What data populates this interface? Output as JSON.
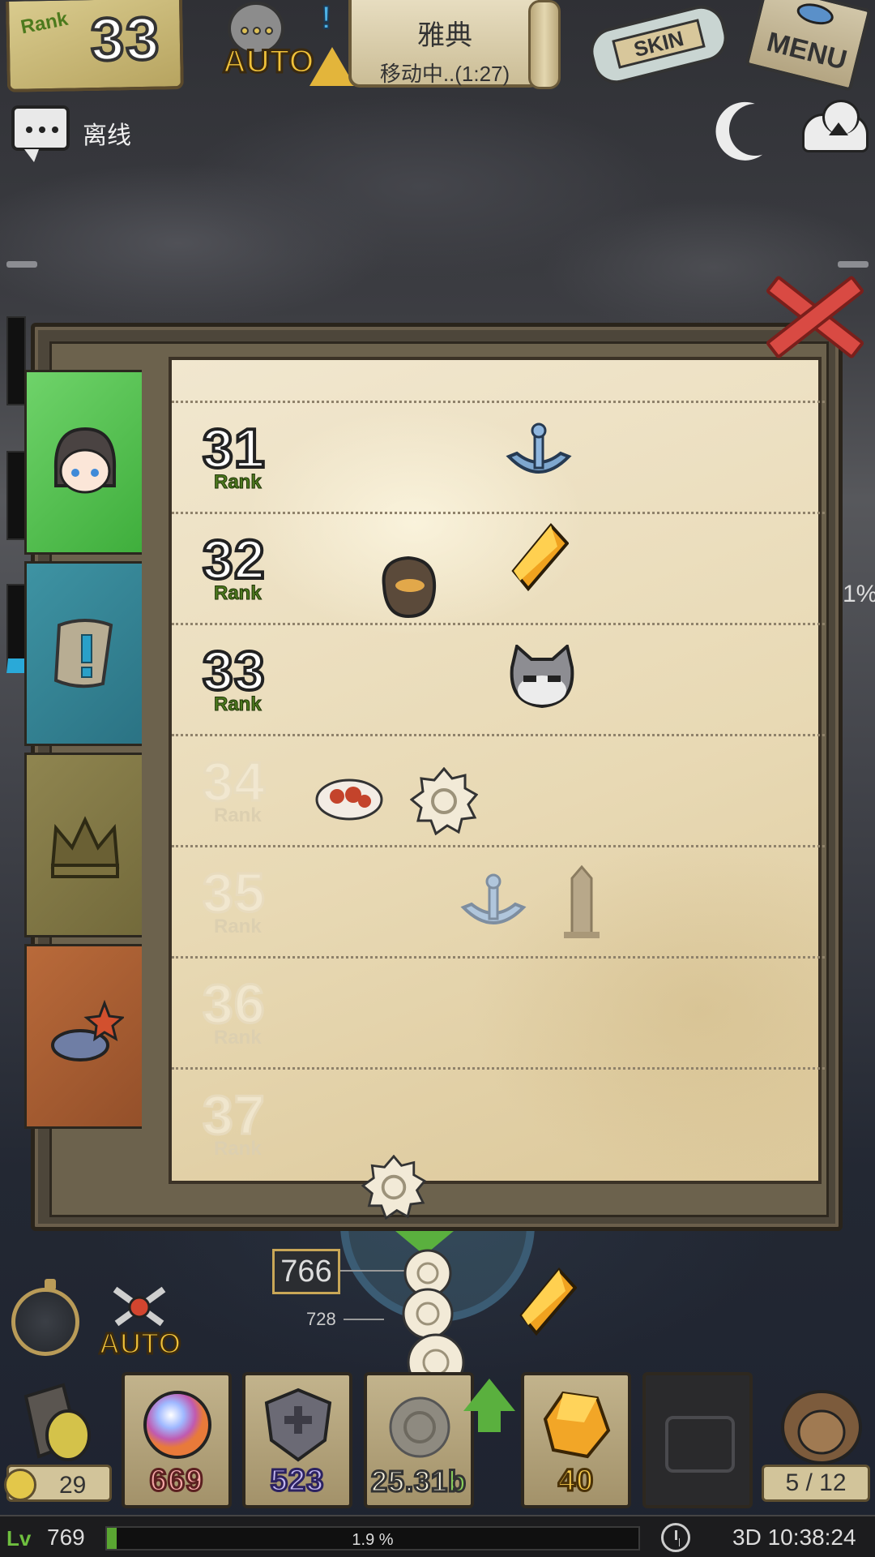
{
  "hud": {
    "rank_label": "Rank",
    "rank_value": "33",
    "auto_label": "AUTO",
    "location": {
      "city": "雅典",
      "status": "移动中..(1:27)"
    },
    "skin_label": "SKIN",
    "menu_label": "MENU",
    "chat_status": "离线",
    "right_percent": "1%"
  },
  "rank_rewards": {
    "rank_word": "Rank",
    "rows": [
      {
        "rank": "31",
        "locked": false,
        "rewards": [
          "anchor-icon"
        ]
      },
      {
        "rank": "32",
        "locked": false,
        "rewards": [
          "ore-icon",
          "amber-gem-icon"
        ]
      },
      {
        "rank": "33",
        "locked": false,
        "rewards": [
          "cat-skin-icon"
        ]
      },
      {
        "rank": "34",
        "locked": true,
        "rewards": [
          "meat-icon",
          "shell-icon"
        ]
      },
      {
        "rank": "35",
        "locked": true,
        "rewards": [
          "anchor-icon",
          "obelisk-icon"
        ]
      },
      {
        "rank": "36",
        "locked": true,
        "rewards": []
      },
      {
        "rank": "37",
        "locked": true,
        "rewards": []
      }
    ]
  },
  "tabs": [
    "character-tab",
    "quest-tab",
    "crown-tab",
    "fish-tab"
  ],
  "battle": {
    "distance_main": "766",
    "distance_sub": "728",
    "auto_label": "AUTO"
  },
  "resources": {
    "gold": "29",
    "orb": "669",
    "shield": "523",
    "shell_number": "25.31",
    "shell_suffix": "b",
    "amber": "40",
    "capacity": "5 / 12"
  },
  "status_bar": {
    "level": "769",
    "xp_percent_text": "1.9 %",
    "xp_fraction": 0.019,
    "time": "3D 10:38:24"
  },
  "colors": {
    "accent_green": "#5ab03e",
    "rank_label_green": "#4d7a1e",
    "close_red": "#d94a43",
    "auto_gold": "#f0c23a"
  }
}
